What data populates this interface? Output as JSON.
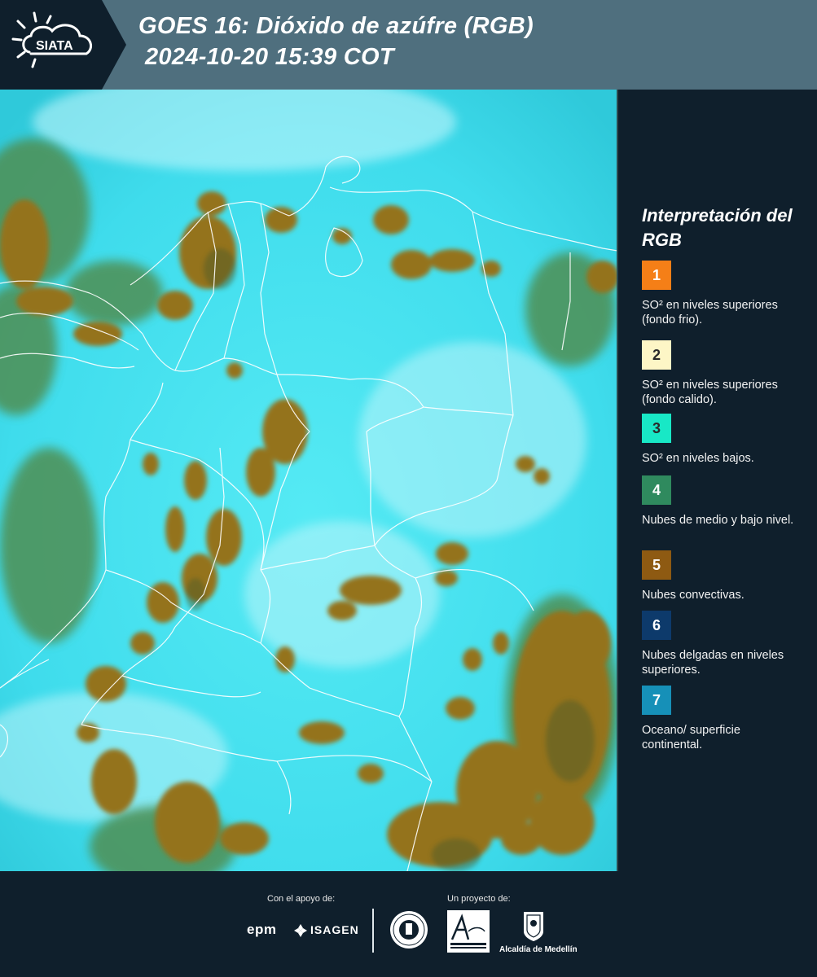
{
  "header": {
    "logo_text": "SIATA",
    "title_line1": "GOES 16: Dióxido de azúfre (RGB)",
    "title_line2": "2024-10-20 15:39 COT"
  },
  "legend": {
    "title": "Interpretación del RGB",
    "items": [
      {
        "number": "1",
        "color": "#f57f17",
        "text": "SO² en niveles superiores (fondo frio)."
      },
      {
        "number": "2",
        "color": "#fdf6c6",
        "text": "SO² en niveles superiores (fondo calido)."
      },
      {
        "number": "3",
        "color": "#18e8c6",
        "text": "SO² en niveles bajos."
      },
      {
        "number": "4",
        "color": "#2f8a5e",
        "text": "Nubes de medio y bajo nivel."
      },
      {
        "number": "5",
        "color": "#8e5a12",
        "text": "Nubes convectivas."
      },
      {
        "number": "6",
        "color": "#0d3a6b",
        "text": "Nubes delgadas en niveles superiores."
      },
      {
        "number": "7",
        "color": "#1690b8",
        "text": "Oceano/ superficie continental."
      }
    ]
  },
  "footer": {
    "support_label": "Con el apoyo de:",
    "project_label": "Un proyecto de:",
    "sponsor_epm": "epm",
    "sponsor_isagen": "ISAGEN",
    "alcaldia": "Alcaldía de Medellín"
  },
  "map_colors": {
    "base": "#3fdcec",
    "convective": "#94731f",
    "low_clouds": "#4f8f52",
    "border": "#ffffff"
  }
}
